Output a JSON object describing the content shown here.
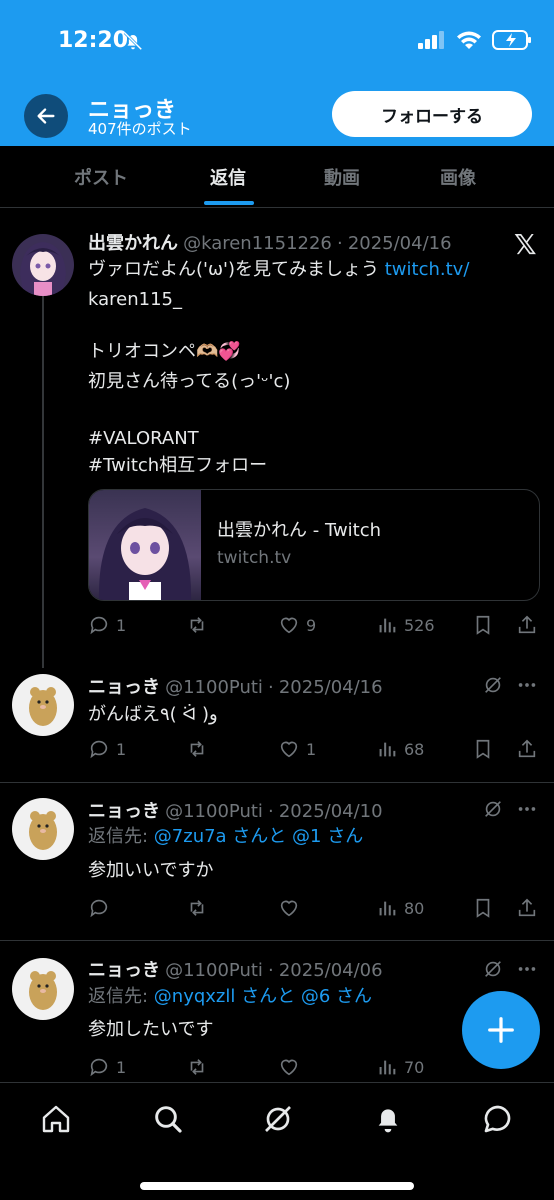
{
  "status": {
    "time": "12:20"
  },
  "header": {
    "title": "ニョっき",
    "subtitle": "407件のポスト",
    "follow_label": "フォローする"
  },
  "tabs": [
    {
      "label": "ポスト",
      "active": false
    },
    {
      "label": "返信",
      "active": true
    },
    {
      "label": "動画",
      "active": false
    },
    {
      "label": "画像",
      "active": false
    }
  ],
  "posts": [
    {
      "name": "出雲かれん",
      "handle": "@karen1151226",
      "date": "2025/04/16",
      "lines": {
        "l1_text": "ヴァロだよん('ω')を見てみましょう ",
        "l1_link": "twitch.tv/",
        "l2_link": "karen115_",
        "l3": "トリオコンペ🫶🏼💞",
        "l4": "初見さん待ってる(っ'ᵕ'c)",
        "tag1": "#VALORANT",
        "tag2": "#Twitch相互フォロー"
      },
      "card": {
        "title": "出雲かれん - Twitch",
        "domain": "twitch.tv"
      },
      "stats": {
        "replies": "1",
        "retweets": "",
        "likes": "9",
        "views": "526"
      }
    },
    {
      "name": "ニョっき",
      "handle": "@1100Puti",
      "date": "2025/04/16",
      "text": "がんばえ٩( ᐛ )و",
      "stats": {
        "replies": "1",
        "retweets": "",
        "likes": "1",
        "views": "68"
      }
    },
    {
      "name": "ニョっき",
      "handle": "@1100Puti",
      "date": "2025/04/10",
      "reply_prefix": "返信先: ",
      "reply_to": "@7zu7a さんと @1 さん",
      "text": "参加いいですか",
      "stats": {
        "replies": "",
        "retweets": "",
        "likes": "",
        "views": "80"
      }
    },
    {
      "name": "ニョっき",
      "handle": "@1100Puti",
      "date": "2025/04/06",
      "reply_prefix": "返信先: ",
      "reply_to": "@nyqxzll さんと @6 さん",
      "text": "参加したいです",
      "stats": {
        "replies": "1",
        "retweets": "",
        "likes": "",
        "views": "70"
      }
    }
  ],
  "icons": {
    "back": "arrow-left-icon",
    "x_logo": "x-logo-icon",
    "reply": "reply-icon",
    "retweet": "retweet-icon",
    "like": "heart-icon",
    "views": "views-icon",
    "bookmark": "bookmark-icon",
    "share": "share-icon",
    "grok": "grok-icon",
    "more": "more-icon",
    "compose": "plus-icon",
    "nav": [
      "home-icon",
      "search-icon",
      "grok-icon",
      "bell-icon",
      "messages-icon"
    ]
  },
  "colors": {
    "accent": "#1d9bf0",
    "background": "#000000",
    "muted": "#71767b"
  }
}
